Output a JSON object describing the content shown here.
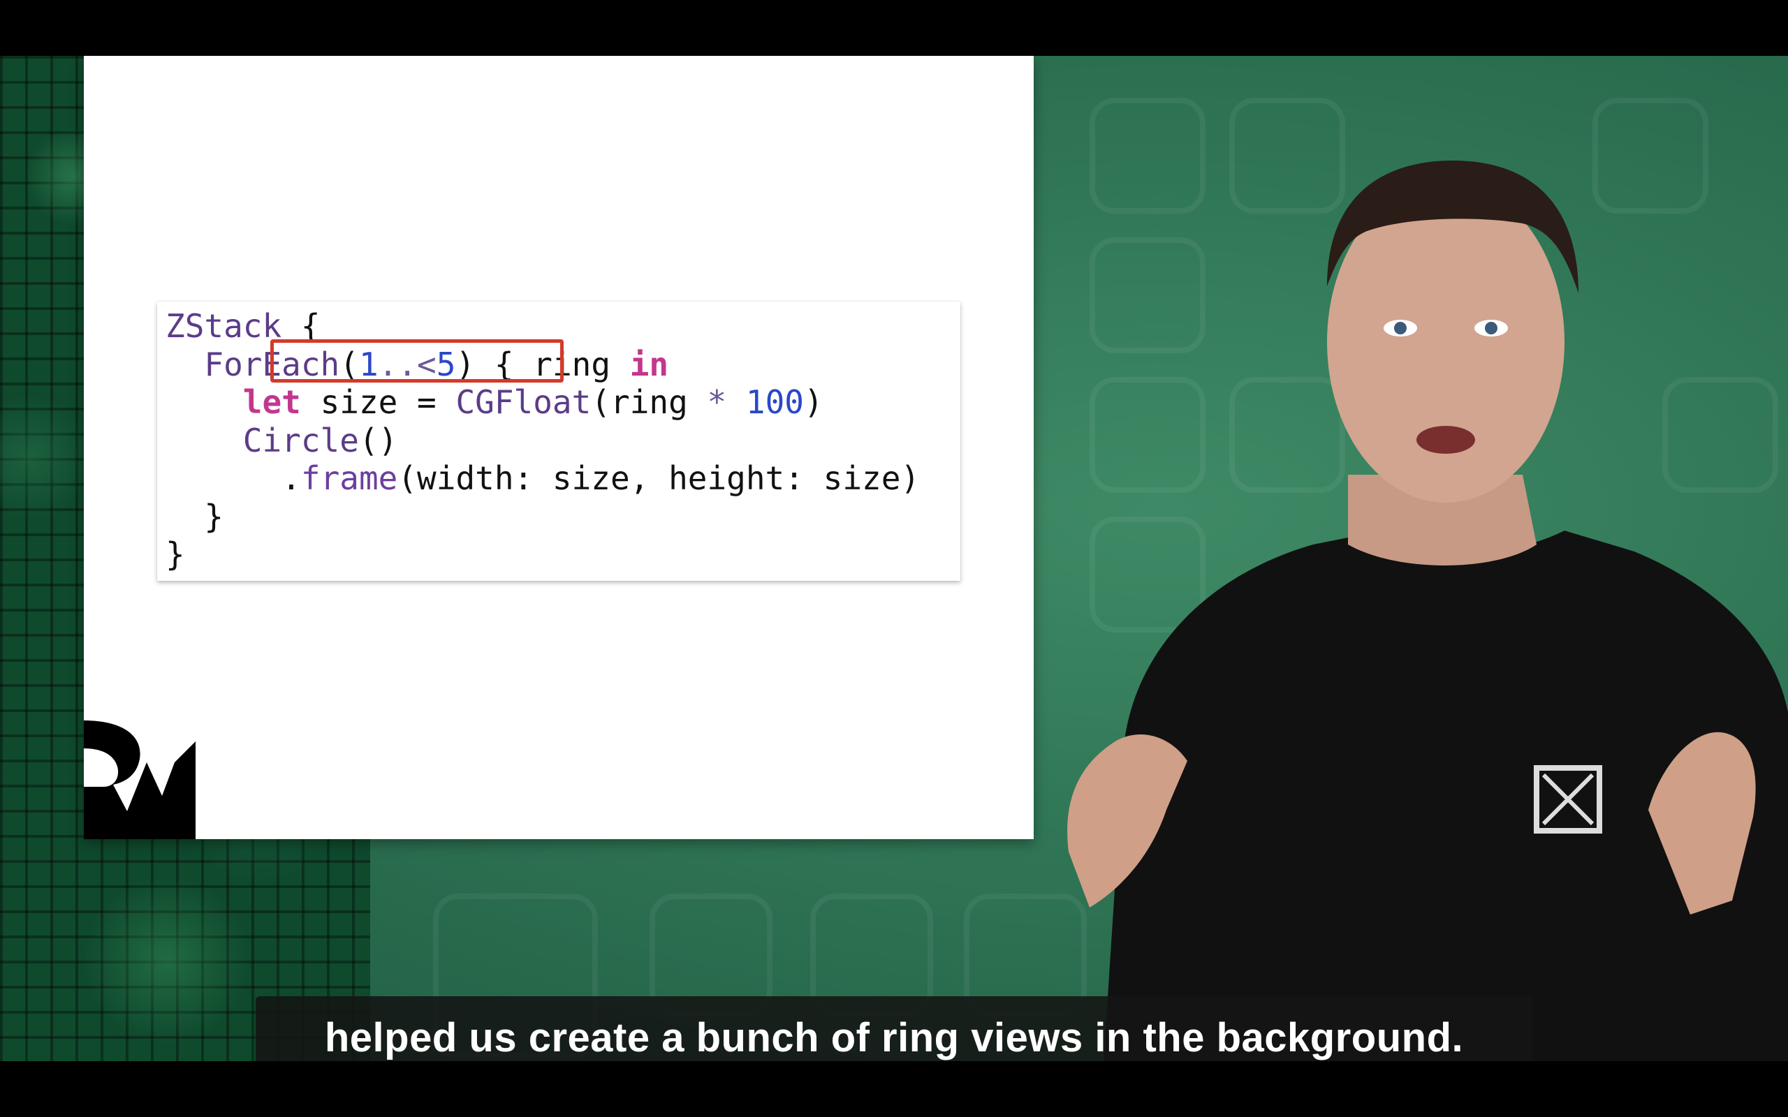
{
  "slide": {
    "code_lines": [
      [
        {
          "t": "ZStack",
          "c": "type"
        },
        {
          "t": " {",
          "c": "plain"
        }
      ],
      [
        {
          "t": "  ",
          "c": "plain"
        },
        {
          "t": "ForEach",
          "c": "type"
        },
        {
          "t": "(",
          "c": "plain"
        },
        {
          "t": "1",
          "c": "num"
        },
        {
          "t": "..<",
          "c": "op"
        },
        {
          "t": "5",
          "c": "num"
        },
        {
          "t": ") { ring ",
          "c": "plain"
        },
        {
          "t": "in",
          "c": "kw"
        }
      ],
      [
        {
          "t": "    ",
          "c": "plain"
        },
        {
          "t": "let",
          "c": "kw"
        },
        {
          "t": " size = ",
          "c": "plain"
        },
        {
          "t": "CGFloat",
          "c": "type"
        },
        {
          "t": "(ring ",
          "c": "plain"
        },
        {
          "t": "*",
          "c": "op"
        },
        {
          "t": " ",
          "c": "plain"
        },
        {
          "t": "100",
          "c": "num"
        },
        {
          "t": ")",
          "c": "plain"
        }
      ],
      [
        {
          "t": "    ",
          "c": "plain"
        },
        {
          "t": "Circle",
          "c": "type"
        },
        {
          "t": "()",
          "c": "plain"
        }
      ],
      [
        {
          "t": "      .",
          "c": "plain"
        },
        {
          "t": "frame",
          "c": "method"
        },
        {
          "t": "(width: size, height: size)",
          "c": "plain"
        }
      ],
      [
        {
          "t": "  }",
          "c": "plain"
        }
      ],
      [
        {
          "t": "}",
          "c": "plain"
        }
      ]
    ],
    "logo": "rw-logo"
  },
  "colors": {
    "highlight_box": "#d33a2a",
    "background_green": "#2f7555"
  },
  "subtitle": {
    "text": "helped us create a bunch of ring views in the background."
  }
}
